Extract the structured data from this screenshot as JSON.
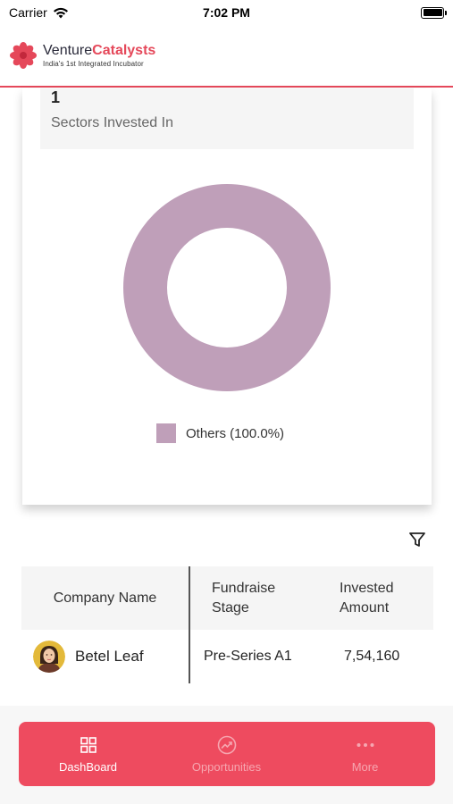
{
  "status_bar": {
    "carrier": "Carrier",
    "time": "7:02 PM"
  },
  "header": {
    "brand_first": "Venture",
    "brand_second": "Catalysts",
    "tagline": "India's 1st Integrated Incubator",
    "logo_icon": "flower-logo-icon",
    "accent_color": "#e5485a"
  },
  "sectors_card": {
    "count": "1",
    "label": "Sectors Invested In"
  },
  "chart_data": {
    "type": "pie",
    "categories": [
      "Others"
    ],
    "values": [
      100.0
    ],
    "colors": [
      "#bf9fb9"
    ],
    "donut": true,
    "legend": "bottom",
    "legend_labels": [
      "Others (100.0%)"
    ]
  },
  "filter": {
    "icon": "filter-icon"
  },
  "table": {
    "headers": [
      {
        "line1": "Company Name",
        "line2": ""
      },
      {
        "line1": "Fundraise",
        "line2": "Stage"
      },
      {
        "line1": "Invested",
        "line2": "Amount"
      }
    ],
    "rows": [
      {
        "company": "Betel Leaf",
        "stage": "Pre-Series A1",
        "amount": "7,54,160",
        "avatar": "avatar"
      }
    ]
  },
  "bottom_nav": {
    "items": [
      {
        "label": "DashBoard",
        "icon": "grid-icon",
        "active": true
      },
      {
        "label": "Opportunities",
        "icon": "trend-chart-icon",
        "active": false
      },
      {
        "label": "More",
        "icon": "more-dots-icon",
        "active": false
      }
    ],
    "background": "#ee4b5f"
  }
}
